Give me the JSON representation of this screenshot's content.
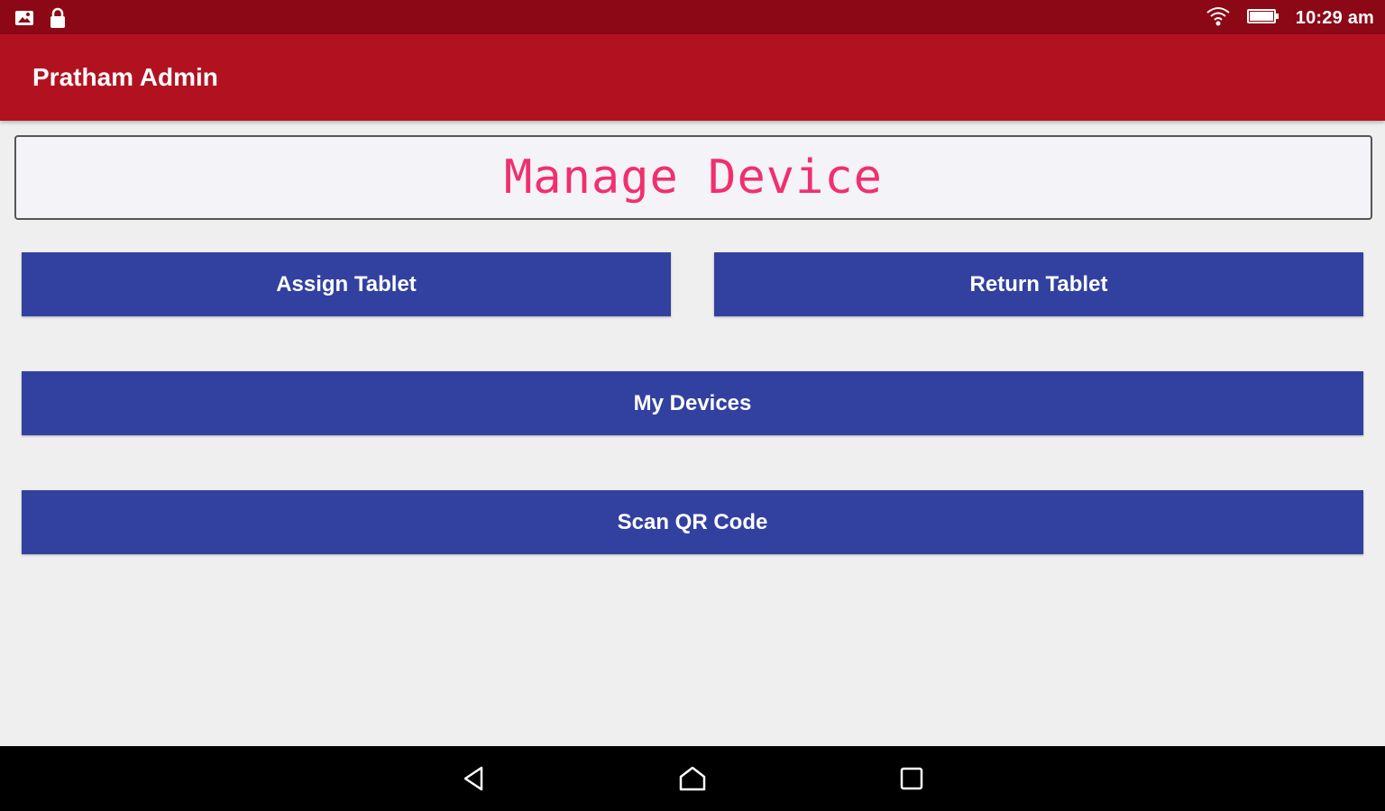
{
  "status_bar": {
    "time": "10:29 am",
    "icons": [
      "gallery-icon",
      "lock-icon",
      "wifi-icon",
      "battery-icon"
    ]
  },
  "app_bar": {
    "title": "Pratham Admin"
  },
  "header": {
    "title": "Manage Device"
  },
  "buttons": {
    "assign_tablet": "Assign Tablet",
    "return_tablet": "Return Tablet",
    "my_devices": "My Devices",
    "scan_qr_code": "Scan QR Code"
  },
  "nav_bar": {
    "icons": [
      "back-icon",
      "home-icon",
      "recents-icon"
    ]
  },
  "colors": {
    "status_bar": "#8c0816",
    "app_bar": "#b21220",
    "button": "#3241a0",
    "header_text": "#f0306e",
    "background": "#efefef"
  }
}
